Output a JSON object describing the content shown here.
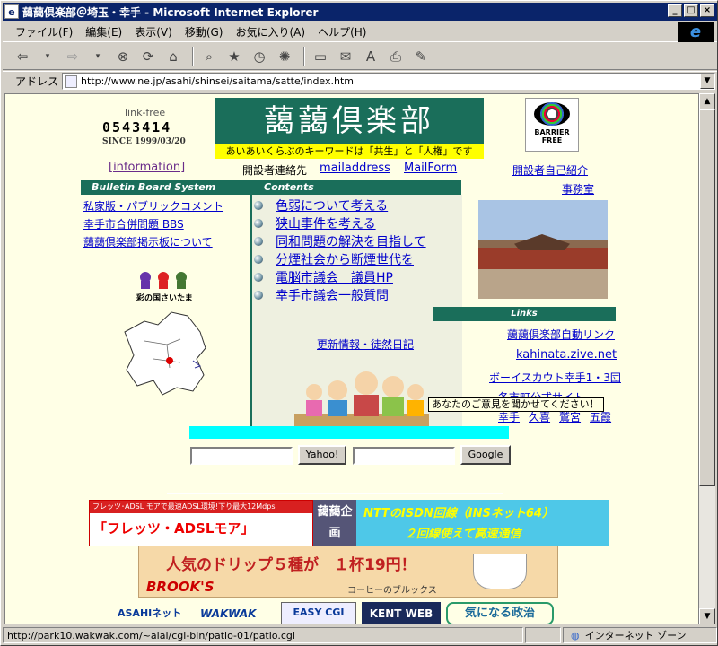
{
  "window": {
    "title": "藹藹倶楽部＠埼玉・幸手 - Microsoft Internet Explorer",
    "min": "_",
    "max": "□",
    "close": "×"
  },
  "menu": [
    "ファイル(F)",
    "編集(E)",
    "表示(V)",
    "移動(G)",
    "お気に入り(A)",
    "ヘルプ(H)"
  ],
  "address": {
    "label": "アドレス",
    "url": "http://www.ne.jp/asahi/shinsei/saitama/satte/index.htm"
  },
  "page": {
    "counter_label": "link-free",
    "counter": "0543414",
    "since": "SINCE 1999/03/20",
    "logo": "藹藹倶楽部",
    "tagline": "あいあいくらぶのキーワードは「共生」と「人権」です",
    "barrier_free": "BARRIER FREE",
    "information": "[information]",
    "contact_label": "開設者連絡先",
    "mailaddress": "mailaddress",
    "mailform": "MailForm",
    "self_intro": "開設者自己紹介",
    "office": "事務室",
    "bbs_header": "Bulletin Board System",
    "contents_header": "Contents",
    "bbs_links": [
      "私家版・パブリックコメント",
      "幸手市合併問題 BBS",
      "藹藹倶楽部掲示板について"
    ],
    "saitama_label": "彩の国さいたま",
    "contents": [
      "色弱について考える",
      "狭山事件を考える",
      "同和問題の解決を目指して",
      "分煙社会から断煙世代を",
      "電脳市議会　議員HP",
      "幸手市議会一般質問"
    ],
    "update_link": "更新情報・徒然日記",
    "links_header": "Links",
    "links": [
      "藹藹倶楽部自動リンク",
      "kahinata.zive.net",
      "ボーイスカウト幸手1・3団",
      "各市町公式サイト"
    ],
    "cities": [
      "幸手",
      "久喜",
      "鷲宮",
      "五霞"
    ],
    "tooltip": "あなたのご意見を聞かせてください！",
    "yahoo_btn": "Yahoo!",
    "google_btn": "Google",
    "ban1_top": "フレッツ･ADSL モアで最速ADSL環境!下り最大12Mdps",
    "ban1_big": "「フレッツ・ADSLモア」",
    "ban1_mid": "藹藹企画",
    "ban1_r1": "NTTのISDN回線（INSネット64）",
    "ban1_r2": "２回線使えて高速通信",
    "ban2_a": "人気のドリップ５種が　１杯19円！",
    "ban2_b": "BROOK'S",
    "ban2_c": "コーヒーのブルックス",
    "ban3": [
      "ASAHIネット",
      "WAKWAK",
      "EASY CGI",
      "KENT WEB",
      "気になる政治"
    ]
  },
  "status": {
    "url": "http://park10.wakwak.com/~aiai/cgi-bin/patio-01/patio.cgi",
    "zone": "インターネット ゾーン"
  },
  "colors": {
    "title_bar": "#0a246a",
    "header_green": "#1a6e5a",
    "page_bg": "#ffffe6"
  }
}
